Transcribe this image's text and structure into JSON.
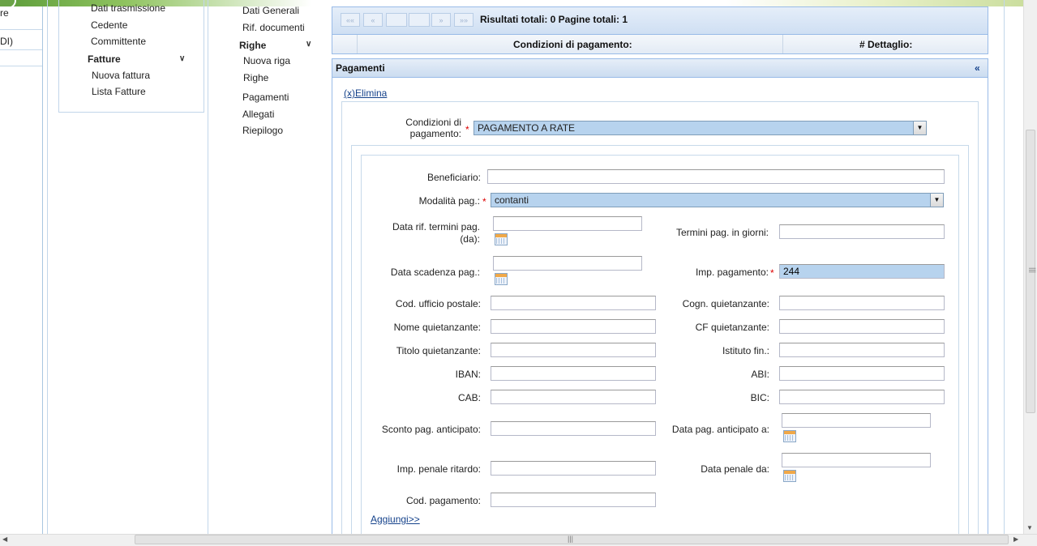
{
  "left_panel": {
    "item_1": "re",
    "item_2": "DI)"
  },
  "menu1": {
    "dati_trasmissione": "Dati trasmissione",
    "cedente": "Cedente",
    "committente": "Committente",
    "fatture": "Fatture",
    "nuova_fattura": "Nuova fattura",
    "lista_fatture": "Lista Fatture"
  },
  "menu2": {
    "dati_generali": "Dati Generali",
    "rif_documenti": "Rif. documenti",
    "righe_header": "Righe",
    "nuova_riga": "Nuova riga",
    "righe": "Righe",
    "pagamenti": "Pagamenti",
    "allegati": "Allegati",
    "riepilogo": "Riepilogo"
  },
  "icons": {
    "chevron": "double-chevron-down-icon",
    "calendar": "calendar-icon",
    "dropdown": "dropdown-arrow-icon"
  },
  "pager": {
    "first": "««",
    "prev": "«",
    "next": "»",
    "last": "»»",
    "info": "Risultati totali: 0 Pagine totali: 1"
  },
  "grid": {
    "col_condizioni": "Condizioni di pagamento:",
    "col_dettaglio": "# Dettaglio:"
  },
  "pagamenti": {
    "title": "Pagamenti",
    "collapse": "«",
    "elimina": "(x)Elimina",
    "condizioni_label_1": "Condizioni di",
    "condizioni_label_2": "pagamento:",
    "condizioni_value": "PAGAMENTO A RATE",
    "aggiungi": "Aggiungi>>"
  },
  "form": {
    "beneficiario_label": "Beneficiario:",
    "beneficiario_value": "",
    "modalita_label": "Modalità pag.:",
    "modalita_value": "contanti",
    "data_rif_label_1": "Data rif. termini pag.",
    "data_rif_label_2": "(da):",
    "termini_label": "Termini pag. in giorni:",
    "data_scadenza_label": "Data scadenza pag.:",
    "imp_pagamento_label": "Imp. pagamento:",
    "imp_pagamento_value": "244",
    "cod_ufficio_label": "Cod. ufficio postale:",
    "cogn_quiet_label": "Cogn. quietanzante:",
    "nome_quiet_label": "Nome quietanzante:",
    "cf_quiet_label": "CF quietanzante:",
    "titolo_quiet_label": "Titolo quietanzante:",
    "istituto_label": "Istituto fin.:",
    "iban_label": "IBAN:",
    "abi_label": "ABI:",
    "cab_label": "CAB:",
    "bic_label": "BIC:",
    "sconto_label": "Sconto pag. anticipato:",
    "data_anticipato_label": "Data pag. anticipato a:",
    "penale_label": "Imp. penale ritardo:",
    "data_penale_label": "Data penale da:",
    "cod_pag_label": "Cod. pagamento:",
    "required_mark": "*"
  },
  "scroll": {
    "grip": "|||"
  }
}
